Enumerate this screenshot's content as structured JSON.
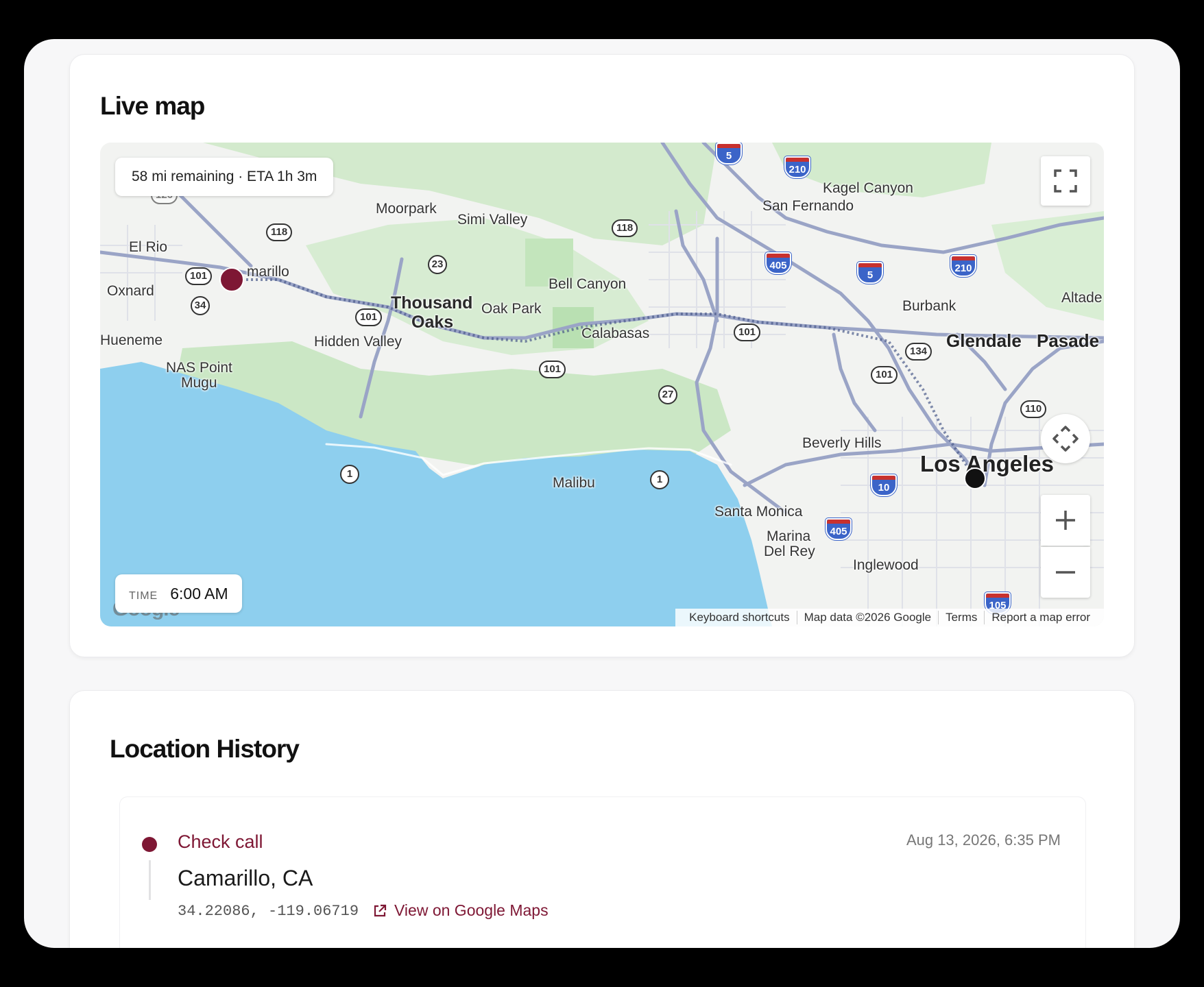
{
  "colors": {
    "accent": "#7e1734",
    "water": "#8ecfee",
    "park": "#cfe9c9",
    "land": "#f2f3f1",
    "highway": "#9aa4c6",
    "interstate_shield": "#3b64c8"
  },
  "live_map": {
    "title": "Live map",
    "eta_text": "58 mi remaining · ETA 1h 3m",
    "time_label": "TIME",
    "time_value": "6:00 AM",
    "google_logo": "Google",
    "attribution": [
      "Keyboard shortcuts",
      "Map data ©2026 Google",
      "Terms",
      "Report a map error"
    ],
    "controls": {
      "fullscreen_icon": "fullscreen-icon",
      "pan_icon": "camera-pan-icon",
      "zoom_in_icon": "plus-icon",
      "zoom_out_icon": "minus-icon"
    },
    "places": {
      "moorpark": "Moorpark",
      "simi_valley": "Simi Valley",
      "kagel_canyon": "Kagel Canyon",
      "san_fernando": "San Fernando",
      "el_rio": "El Rio",
      "camarillo": "marillo",
      "oxnard": "Oxnard",
      "thousand": "Thousand",
      "oaks": "Oaks",
      "oak_park": "Oak Park",
      "bell_canyon": "Bell Canyon",
      "burbank": "Burbank",
      "altadena": "Altade",
      "hueneme": "Hueneme",
      "hidden_valley": "Hidden Valley",
      "calabasas": "Calabasas",
      "glendale": "Glendale",
      "pasadena": "Pasade",
      "nas_point": "NAS Point",
      "mugu": "Mugu",
      "beverly_hills": "Beverly Hills",
      "los_angeles": "Los Angeles",
      "malibu": "Malibu",
      "santa_monica": "Santa Monica",
      "marina": "Marina",
      "del_rey": "Del Rey",
      "inglewood": "Inglewood"
    },
    "shields": {
      "us101_a": "101",
      "us101_b": "101",
      "us101_c": "101",
      "us101_d": "101",
      "us101_e": "101",
      "ca118_a": "118",
      "ca118_b": "118",
      "ca23": "23",
      "ca34": "34",
      "ca27": "27",
      "ca1_a": "1",
      "ca1_b": "1",
      "ca134": "134",
      "ca110": "110",
      "ca126": "126",
      "i5_a": "5",
      "i5_b": "5",
      "i210_a": "210",
      "i210_b": "210",
      "i405_a": "405",
      "i405_b": "405",
      "i10": "10",
      "i105": "105"
    }
  },
  "location_history": {
    "title": "Location History",
    "items": [
      {
        "type": "Check call",
        "place": "Camarillo, CA",
        "coords": "34.22086, -119.06719",
        "link_label": "View on Google Maps",
        "timestamp": "Aug 13, 2026, 6:35 PM"
      }
    ]
  }
}
